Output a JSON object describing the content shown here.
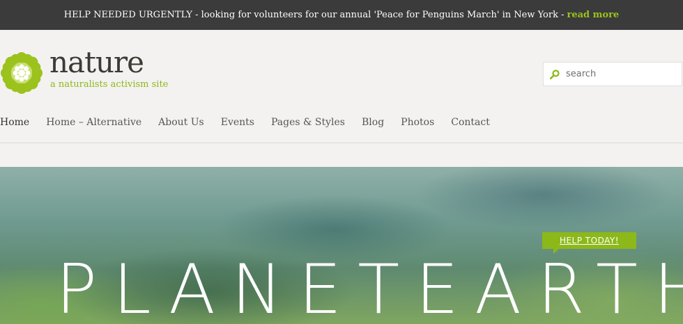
{
  "announcement": {
    "text": "HELP NEEDED URGENTLY - looking for volunteers for our annual 'Peace for Penguins March' in New York -",
    "link": "read more"
  },
  "logo": {
    "title": "nature",
    "tagline": "a naturalists activism site",
    "icon": "flower-logo-icon"
  },
  "search": {
    "placeholder": "search",
    "icon": "search-icon"
  },
  "nav": {
    "items": [
      {
        "label": "Home",
        "active": true
      },
      {
        "label": "Home – Alternative"
      },
      {
        "label": "About Us"
      },
      {
        "label": "Events"
      },
      {
        "label": "Pages & Styles"
      },
      {
        "label": "Blog"
      },
      {
        "label": "Photos"
      },
      {
        "label": "Contact"
      }
    ]
  },
  "hero": {
    "badge": "HELP TODAY!",
    "title": "PLANETEARTH"
  },
  "colors": {
    "accent": "#8cb81a",
    "topbar": "#3b3b3b",
    "background": "#f3f2f0"
  }
}
